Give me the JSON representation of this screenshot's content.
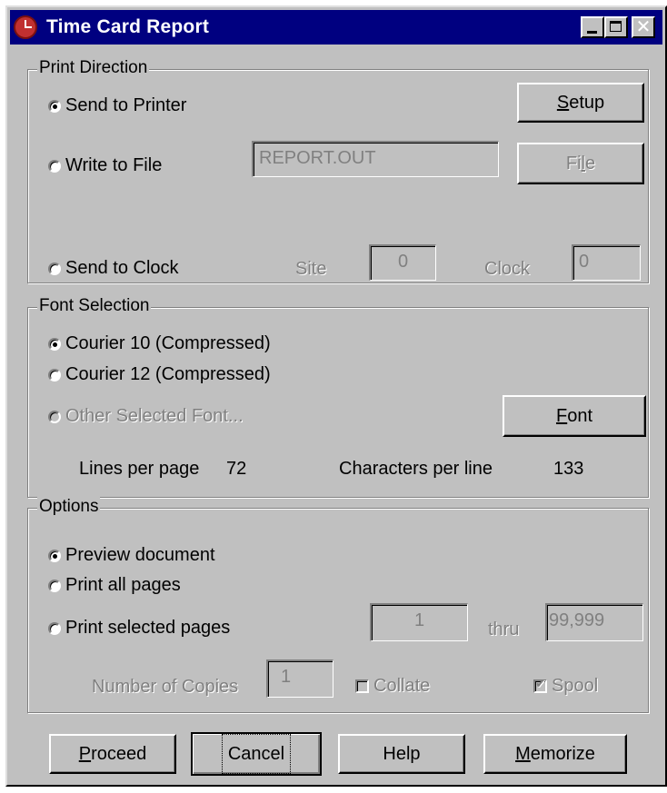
{
  "window": {
    "title": "Time Card Report"
  },
  "print_direction": {
    "legend": "Print Direction",
    "send_to_printer": "Send to Printer",
    "write_to_file": "Write to File",
    "send_to_clock": "Send to Clock",
    "selected": "send_to_printer",
    "setup_button": "Setup",
    "file_button": "File",
    "file_name_value": "REPORT.OUT",
    "site_label": "Site",
    "site_value": "0",
    "clock_label": "Clock",
    "clock_value": "0"
  },
  "font_selection": {
    "legend": "Font Selection",
    "courier10": "Courier 10 (Compressed)",
    "courier12": "Courier 12 (Compressed)",
    "other_font": "Other Selected Font...",
    "selected": "courier10",
    "font_button": "Font",
    "lines_per_page_label": "Lines per page",
    "lines_per_page_value": "72",
    "chars_per_line_label": "Characters per line",
    "chars_per_line_value": "133"
  },
  "options": {
    "legend": "Options",
    "preview": "Preview document",
    "print_all": "Print all pages",
    "print_selected": "Print selected pages",
    "selected": "preview",
    "from_page_value": "1",
    "thru_label": "thru",
    "to_page_value": "99,999",
    "copies_label": "Number of Copies",
    "copies_value": "1",
    "collate_label": "Collate",
    "collate_checked": false,
    "spool_label": "Spool",
    "spool_checked": true
  },
  "buttons": {
    "proceed": "Proceed",
    "cancel": "Cancel",
    "help": "Help",
    "memorize": "Memorize"
  }
}
